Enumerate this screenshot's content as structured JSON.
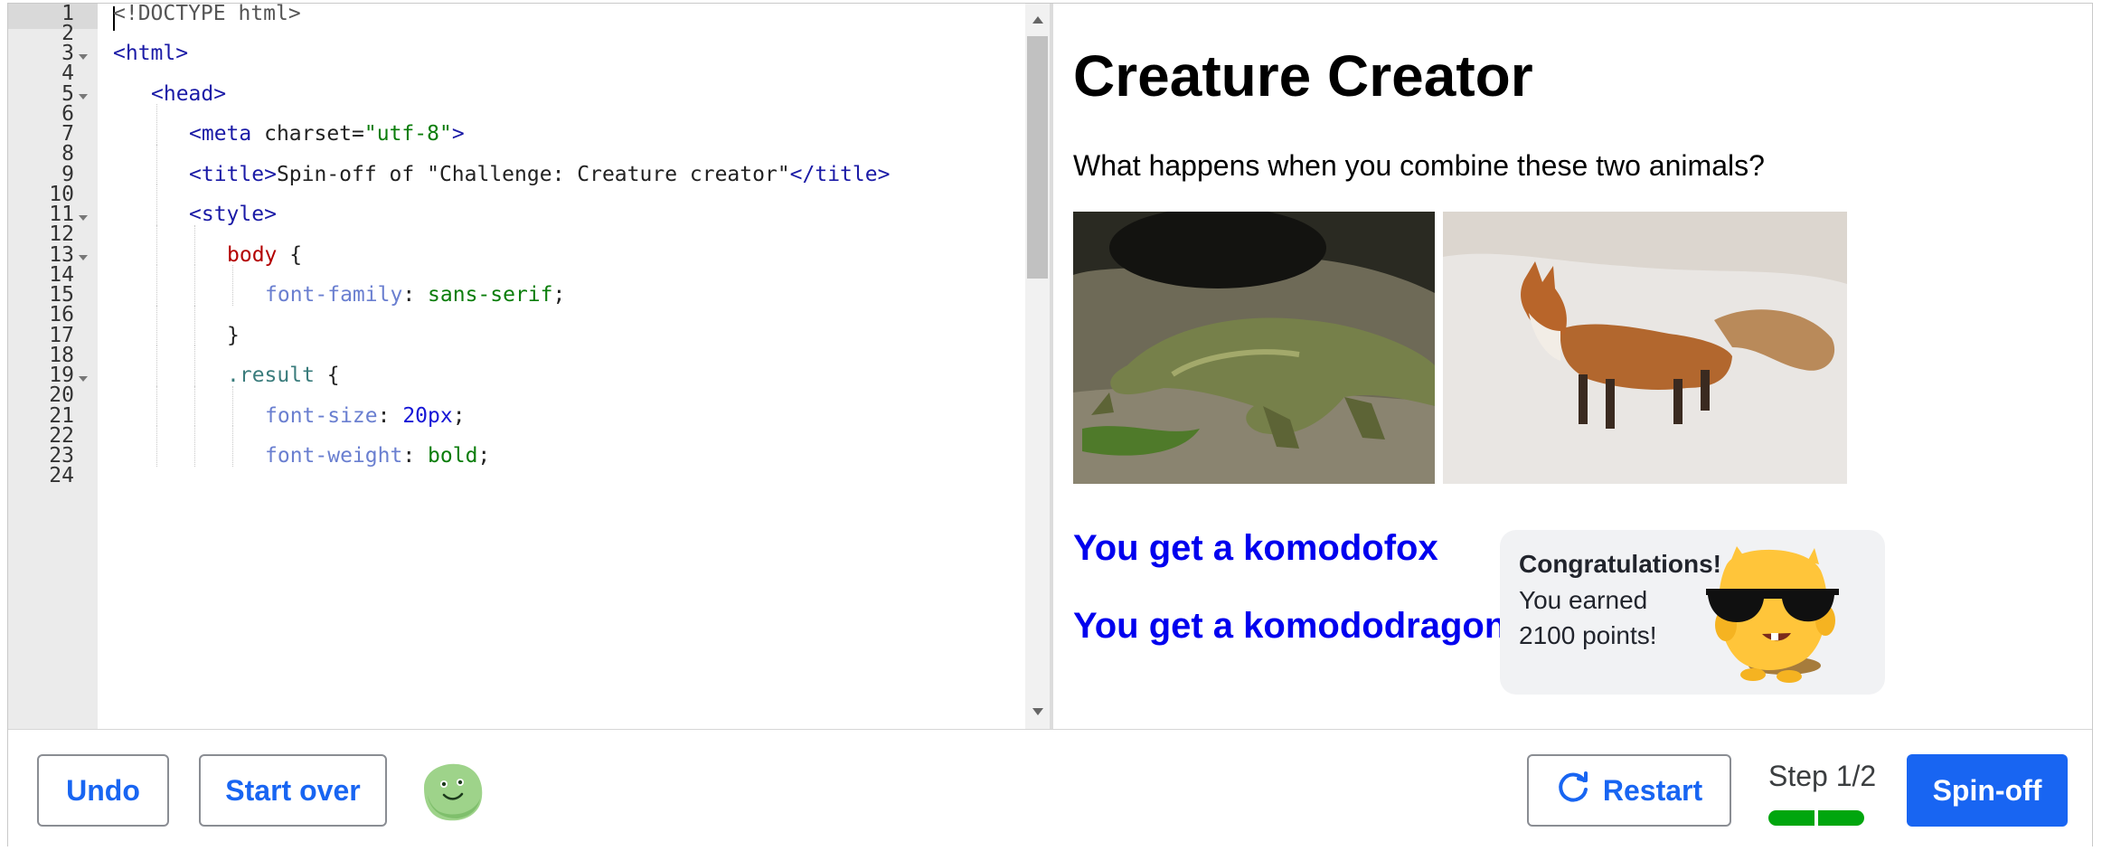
{
  "editor": {
    "line_numbers": [
      "1",
      "2",
      "3",
      "4",
      "5",
      "6",
      "7",
      "8",
      "9",
      "10",
      "11",
      "12",
      "13",
      "14",
      "15",
      "16",
      "17",
      "18",
      "19",
      "20",
      "21",
      "22",
      "23",
      "24"
    ],
    "lines": [
      {
        "n": 1,
        "parts": [
          {
            "t": "doc",
            "v": "<!DOCTYPE html>"
          }
        ]
      },
      {
        "n": 3,
        "parts": [
          {
            "t": "tag",
            "v": "<html>"
          }
        ]
      },
      {
        "n": 5,
        "parts": [
          {
            "t": "tag",
            "v": "<head>"
          }
        ]
      },
      {
        "n": 7,
        "parts": [
          {
            "t": "tag",
            "v": "<meta"
          },
          {
            "t": "attr",
            "v": " charset="
          },
          {
            "t": "str",
            "v": "\"utf-8\""
          },
          {
            "t": "tag",
            "v": ">"
          }
        ]
      },
      {
        "n": 9,
        "parts": [
          {
            "t": "tag",
            "v": "<title>"
          },
          {
            "t": "attr",
            "v": "Spin-off of \"Challenge: Creature creator\""
          },
          {
            "t": "tag",
            "v": "</title>"
          }
        ]
      },
      {
        "n": 11,
        "parts": [
          {
            "t": "tag",
            "v": "<style>"
          }
        ]
      },
      {
        "n": 13,
        "parts": [
          {
            "t": "sel",
            "v": "body"
          },
          {
            "t": "attr",
            "v": " {"
          }
        ]
      },
      {
        "n": 15,
        "parts": [
          {
            "t": "prop",
            "v": "font-family"
          },
          {
            "t": "attr",
            "v": ": "
          },
          {
            "t": "val",
            "v": "sans-serif"
          },
          {
            "t": "attr",
            "v": ";"
          }
        ]
      },
      {
        "n": 17,
        "parts": [
          {
            "t": "attr",
            "v": "}"
          }
        ]
      },
      {
        "n": 19,
        "parts": [
          {
            "t": "cls",
            "v": ".result"
          },
          {
            "t": "attr",
            "v": " {"
          }
        ]
      },
      {
        "n": 21,
        "parts": [
          {
            "t": "prop",
            "v": "font-size"
          },
          {
            "t": "attr",
            "v": ": "
          },
          {
            "t": "num",
            "v": "20px"
          },
          {
            "t": "attr",
            "v": ";"
          }
        ]
      },
      {
        "n": 23,
        "parts": [
          {
            "t": "prop",
            "v": "font-weight"
          },
          {
            "t": "attr",
            "v": ": "
          },
          {
            "t": "val",
            "v": "bold"
          },
          {
            "t": "attr",
            "v": ";"
          }
        ]
      }
    ]
  },
  "preview": {
    "title": "Creature Creator",
    "subtitle": "What happens when you combine these two animals?",
    "images": [
      {
        "name": "komodo-dragon-photo"
      },
      {
        "name": "red-fox-photo"
      }
    ],
    "results": [
      "You get a komodofox",
      "You get a komododragon"
    ],
    "toast": {
      "title": "Congratulations!",
      "line1": "You earned",
      "line2": "2100 points!"
    }
  },
  "footer": {
    "undo_label": "Undo",
    "start_over_label": "Start over",
    "restart_label": "Restart",
    "step_label": "Step 1/2",
    "spinoff_label": "Spin-off"
  },
  "colors": {
    "accent": "#1865f2",
    "progress": "#00a60e",
    "link": "#0000ee"
  },
  "icons": [
    "fold-arrow-icon",
    "restart-icon",
    "helper-avatar-icon",
    "mascot-sunglasses-icon"
  ]
}
